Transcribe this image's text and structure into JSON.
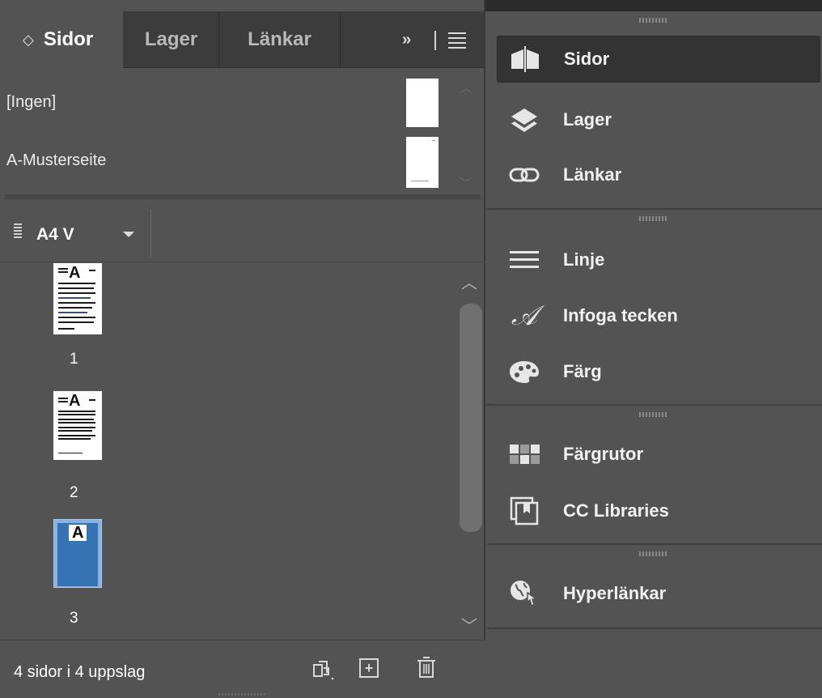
{
  "tabs": {
    "active_chevron": "◇",
    "sidor": "Sidor",
    "lager": "Lager",
    "lankar": "Länkar",
    "more": "››"
  },
  "masters": {
    "none_label": "[Ingen]",
    "a_label": "A-Musterseite"
  },
  "size_toolbar": {
    "size_label": "A4 V"
  },
  "pages": [
    {
      "number": "1",
      "prefix": "A",
      "selected": false
    },
    {
      "number": "2",
      "prefix": "A",
      "selected": false
    },
    {
      "number": "3",
      "prefix": "A",
      "selected": true
    }
  ],
  "footer": {
    "status": "4 sidor i 4 uppslag"
  },
  "dock": {
    "group1": [
      "Sidor",
      "Lager",
      "Länkar"
    ],
    "group2": [
      "Linje",
      "Infoga tecken",
      "Färg"
    ],
    "group3": [
      "Färgrutor",
      "CC Libraries"
    ],
    "group4": [
      "Hyperlänkar"
    ],
    "items": {
      "sidor": "Sidor",
      "lager": "Lager",
      "lankar": "Länkar",
      "linje": "Linje",
      "infoga_tecken": "Infoga tecken",
      "farg": "Färg",
      "fargrutor": "Färgrutor",
      "cc_libraries": "CC Libraries",
      "hyperlankar": "Hyperlänkar"
    },
    "active_item": "Sidor"
  },
  "colors": {
    "panel_bg": "#535353",
    "tabbar_bg": "#3c3c3c",
    "selected_page": "#8ab2e0",
    "active_dock_bg": "#333333"
  }
}
